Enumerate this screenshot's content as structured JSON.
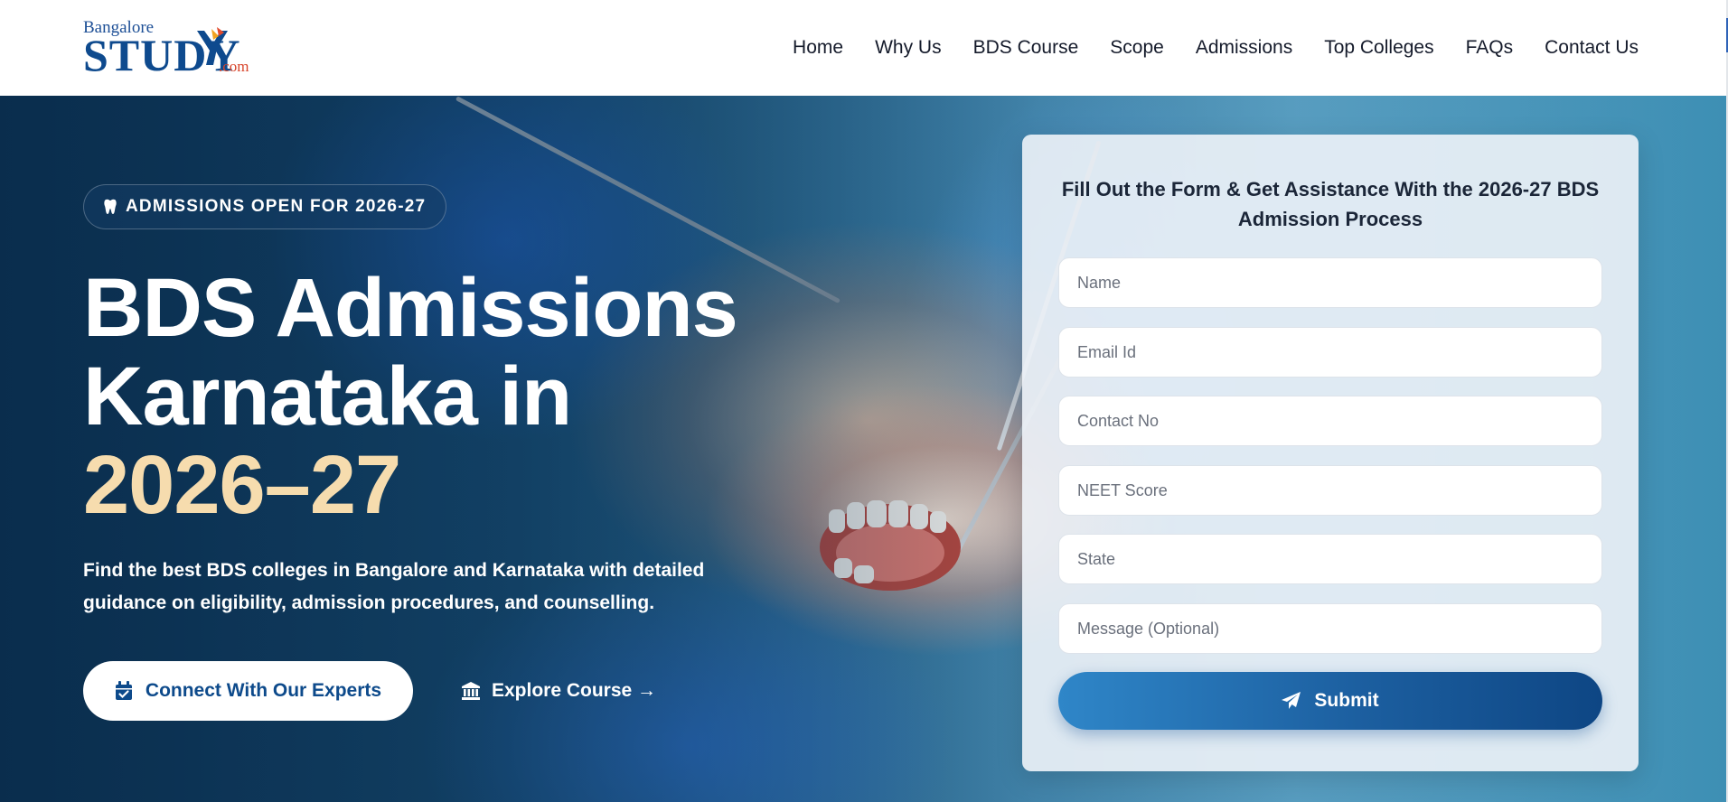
{
  "logo": {
    "top": "Bangalore",
    "main": "STUDY",
    "suffix": ".com"
  },
  "nav": [
    {
      "label": "Home"
    },
    {
      "label": "Why Us"
    },
    {
      "label": "BDS Course"
    },
    {
      "label": "Scope"
    },
    {
      "label": "Admissions"
    },
    {
      "label": "Top Colleges"
    },
    {
      "label": "FAQs"
    },
    {
      "label": "Contact Us"
    }
  ],
  "hero": {
    "badge": {
      "icon": "tooth-icon",
      "text": "ADMISSIONS OPEN FOR 2026-27"
    },
    "title_line1": "BDS Admissions",
    "title_line2": "Karnataka in",
    "title_highlight": "2026–27",
    "subtitle": "Find the best BDS colleges in Bangalore and Karnataka with detailed guidance on eligibility, admission procedures, and counselling.",
    "primary_button": {
      "icon": "calendar-check-icon",
      "label": "Connect With Our Experts"
    },
    "secondary_button": {
      "icon": "institution-icon",
      "label": "Explore Course →"
    }
  },
  "form": {
    "title": "Fill Out the Form & Get Assistance With the 2026-27 BDS Admission Process",
    "fields": {
      "name": "Name",
      "email": "Email Id",
      "contact": "Contact No",
      "neet": "NEET Score",
      "state": "State",
      "message": "Message (Optional)"
    },
    "submit": {
      "icon": "paper-plane-icon",
      "label": "Submit"
    }
  },
  "colors": {
    "brand_blue": "#0d4a8b",
    "highlight": "#f6dcae",
    "logo_accent": "#d8442a"
  }
}
